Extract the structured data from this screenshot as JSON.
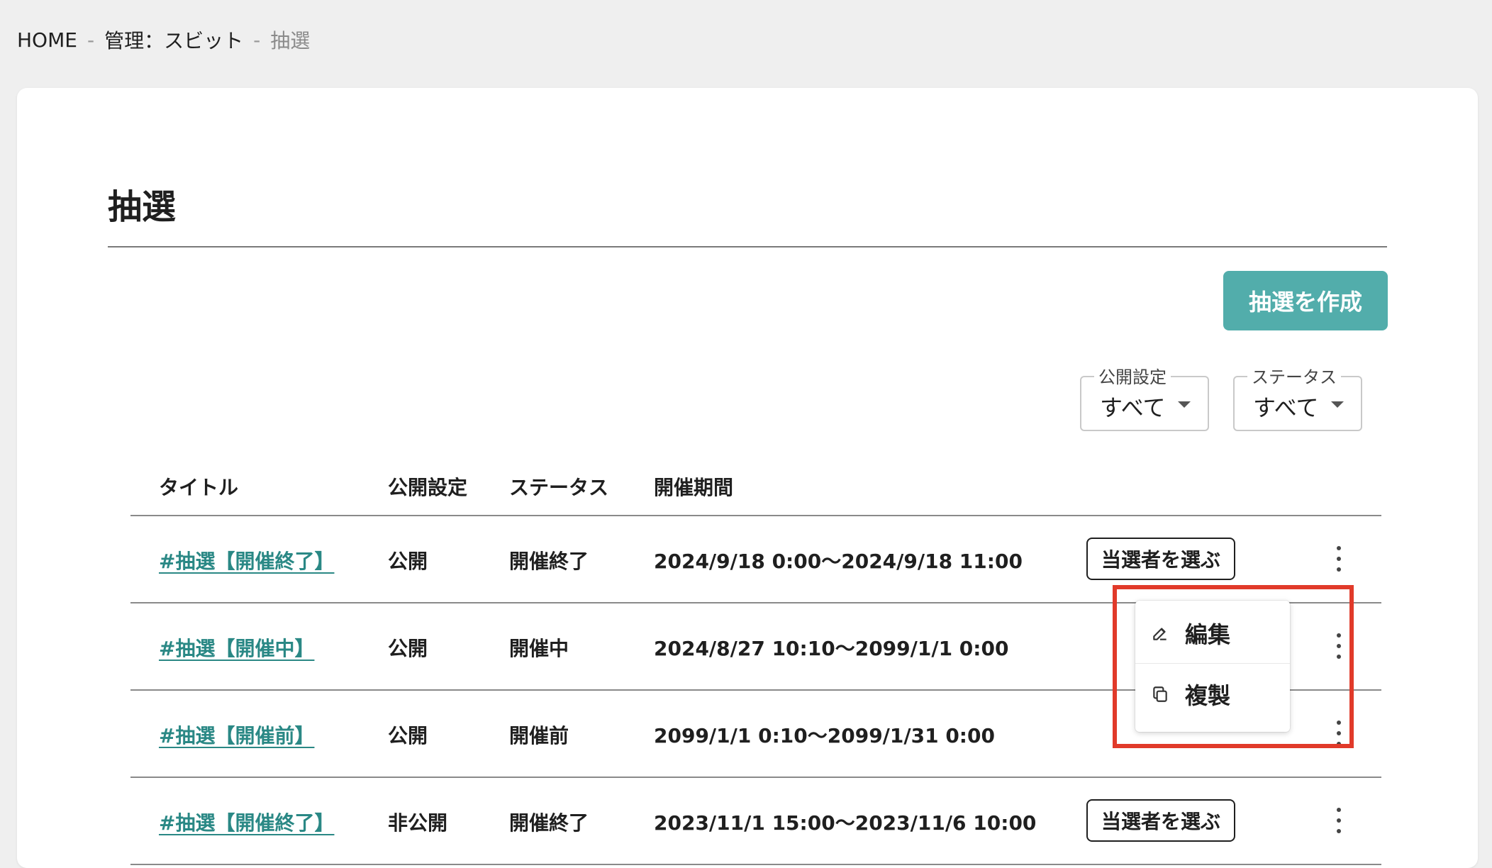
{
  "breadcrumb": {
    "home": "HOME",
    "sep": "-",
    "parent": "管理：スビット",
    "current": "抽選"
  },
  "page": {
    "title": "抽選",
    "create_button": "抽選を作成"
  },
  "filters": {
    "publish": {
      "label": "公開設定",
      "value": "すべて"
    },
    "status": {
      "label": "ステータス",
      "value": "すべて"
    }
  },
  "table": {
    "headers": [
      "タイトル",
      "公開設定",
      "ステータス",
      "開催期間"
    ],
    "rows": [
      {
        "title": "#抽選【開催終了】",
        "publish": "公開",
        "status": "開催終了",
        "period": "2024/9/18 0:00〜2024/9/18 11:00",
        "action": "当選者を選ぶ"
      },
      {
        "title": "#抽選【開催中】",
        "publish": "公開",
        "status": "開催中",
        "period": "2024/8/27 10:10〜2099/1/1 0:00",
        "action": ""
      },
      {
        "title": "#抽選【開催前】",
        "publish": "公開",
        "status": "開催前",
        "period": "2099/1/1 0:10〜2099/1/31 0:00",
        "action": ""
      },
      {
        "title": "#抽選【開催終了】",
        "publish": "非公開",
        "status": "開催終了",
        "period": "2023/11/1 15:00〜2023/11/6 10:00",
        "action": "当選者を選ぶ"
      }
    ]
  },
  "context_menu": {
    "edit": "編集",
    "copy": "複製"
  },
  "colors": {
    "accent": "#52adab",
    "link": "#2a8885",
    "highlight": "#e13a2a",
    "background": "#efefef"
  },
  "icons": {
    "menu": "more-vertical-icon",
    "edit": "edit-icon",
    "copy": "copy-icon",
    "dropdown": "caret-down-icon"
  }
}
